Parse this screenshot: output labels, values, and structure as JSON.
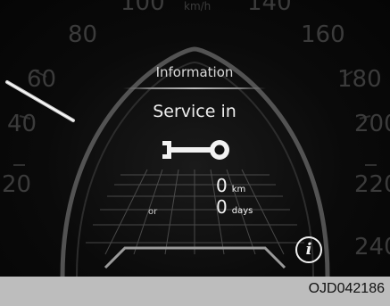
{
  "speedometer": {
    "labels": [
      "80",
      "60",
      "40",
      "20",
      "100",
      "140",
      "160",
      "180",
      "200",
      "220",
      "240",
      "km/h"
    ]
  },
  "panel": {
    "title": "Information",
    "subtitle": "Service in",
    "icon": "wrench-icon",
    "distance": {
      "value": "0",
      "unit": "km"
    },
    "connector": "or",
    "time": {
      "value": "0",
      "unit": "days"
    },
    "info_icon_glyph": "i"
  },
  "caption": "OJD042186"
}
